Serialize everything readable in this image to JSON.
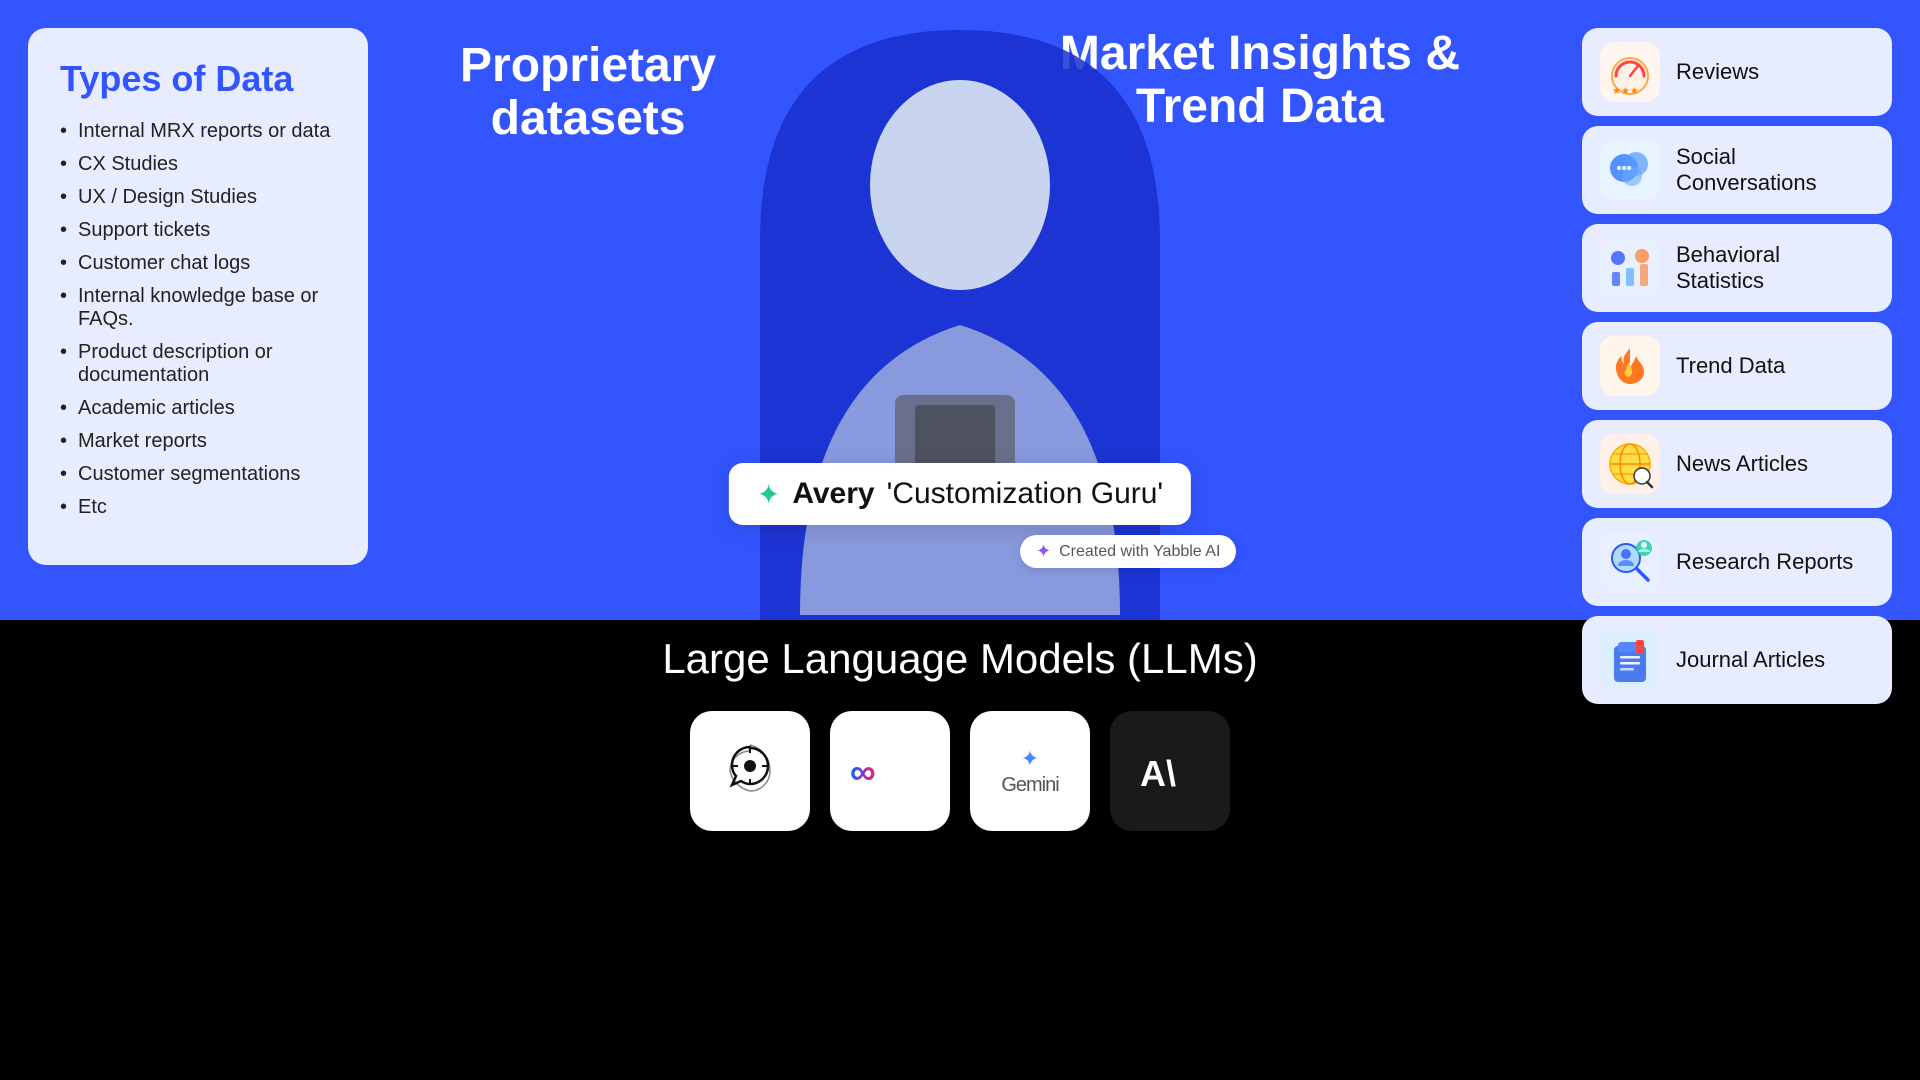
{
  "left_card": {
    "title": "Types of Data",
    "items": [
      "Internal MRX reports or data",
      "CX Studies",
      "UX / Design Studies",
      "Support tickets",
      "Customer chat logs",
      "Internal knowledge base or FAQs.",
      "Product description or documentation",
      "Academic articles",
      "Market reports",
      "Customer segmentations",
      "Etc"
    ]
  },
  "center": {
    "proprietary_label": "Proprietary\ndatasets",
    "market_label": "Market Insights &\nTrend Data",
    "avery_name": "Avery",
    "avery_title": "'Customization Guru'",
    "created_badge": "Created with Yabble AI",
    "llm_title": "Large Language Models (LLMs)"
  },
  "llm_logos": [
    {
      "name": "OpenAI",
      "symbol": "⊕"
    },
    {
      "name": "Meta",
      "symbol": "∞"
    },
    {
      "name": "Gemini",
      "symbol": "✦"
    },
    {
      "name": "Anthropic",
      "symbol": "A\\"
    }
  ],
  "right_cards": [
    {
      "id": "reviews",
      "label": "Reviews",
      "icon": "⭐",
      "icon_bg": "icon-reviews"
    },
    {
      "id": "social",
      "label": "Social Conversations",
      "icon": "💬",
      "icon_bg": "icon-social"
    },
    {
      "id": "behavioral",
      "label": "Behavioral Statistics",
      "icon": "📊",
      "icon_bg": "icon-behavioral"
    },
    {
      "id": "trend",
      "label": "Trend Data",
      "icon": "🔥",
      "icon_bg": "icon-trend"
    },
    {
      "id": "news",
      "label": "News Articles",
      "icon": "🌐",
      "icon_bg": "icon-news"
    },
    {
      "id": "research",
      "label": "Research Reports",
      "icon": "🔍",
      "icon_bg": "icon-research"
    },
    {
      "id": "journal",
      "label": "Journal Articles",
      "icon": "📋",
      "icon_bg": "icon-journal"
    }
  ],
  "colors": {
    "blue_bg": "#3355ff",
    "card_bg": "#e8ecff",
    "title_blue": "#3355ff"
  }
}
